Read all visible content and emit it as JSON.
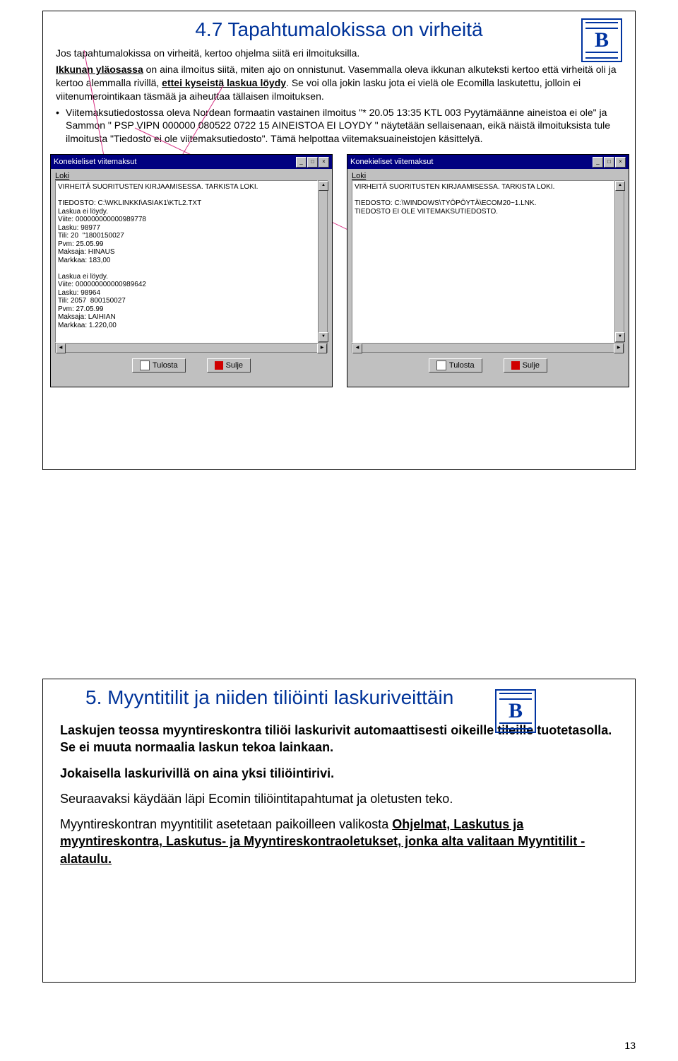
{
  "slide1": {
    "title": "4.7 Tapahtumalokissa on virheitä",
    "p1a": "Jos tapahtumalokissa on virheitä, kertoo ohjelma siitä eri ilmoituksilla.",
    "p2_lead_u": "Ikkunan yläosassa",
    "p2_rest": " on aina ilmoitus siitä, miten ajo on onnistunut. Vasemmalla oleva ikkunan alkuteksti kertoo että virheitä oli ja kertoo alemmalla rivillä, ",
    "p2_mid_u": "ettei kyseistä laskua löydy",
    "p2_tail": ". Se voi olla jokin lasku jota ei vielä ole Ecomilla laskutettu, jolloin ei viitenumerointikaan täsmää ja aiheuttaa tällaisen ilmoituksen.",
    "bullet1": "Viitemaksutiedostossa oleva Nordean formaatin vastainen ilmoitus \"* 20.05 13:35 KTL 003 Pyytämäänne aineistoa ei ole\" ja Sammon \" PSP VIPN 000000 080522 0722 15 AINEISTOA EI LOYDY \" näytetään sellaisenaan, eikä näistä ilmoituksista tule ilmoitusta \"Tiedosto ei ole viitemaksutiedosto\". Tämä helpottaa viitemaksuaineistojen käsittelyä.",
    "win_title": "Konekieliset viitemaksut",
    "loki_label": "Loki",
    "ta_left": "VIRHEITÄ SUORITUSTEN KIRJAAMISESSA. TARKISTA LOKI.\n\nTIEDOSTO: C:\\WKLINKKI\\ASIAK1\\KTL2.TXT\nLaskua ei löydy.\nViite: 000000000000989778\nLasku: 98977\nTili: 20  \"1800150027\nPvm: 25.05.99\nMaksaja: HINAUS\nMarkkaa: 183,00\n\nLaskua ei löydy.\nViite: 000000000000989642\nLasku: 98964\nTili: 2057  800150027\nPvm: 27.05.99\nMaksaja: LAIHIAN\nMarkkaa: 1.220,00",
    "ta_right": "VIRHEITÄ SUORITUSTEN KIRJAAMISESSA. TARKISTA LOKI.\n\nTIEDOSTO: C:\\WINDOWS\\TYÖPÖYTÄ\\ECOM20~1.LNK.\nTIEDOSTO EI OLE VIITEMAKSUTIEDOSTO.",
    "btn_print": "Tulosta",
    "btn_close": "Sulje"
  },
  "slide2": {
    "title": "5. Myyntitilit ja niiden tiliöinti laskuriveittäin",
    "p1_a": "Laskujen teossa myyntireskontra tiliöi laskurivit automaattisesti oikeille tileille tuotetasolla. ",
    "p1_b": "Se ei muuta normaalia laskun tekoa lainkaan.",
    "p2": "Jokaisella laskurivillä on aina yksi tiliöintirivi.",
    "p3": "Seuraavaksi käydään läpi Ecomin tiliöintitapahtumat ja oletusten teko.",
    "p4_a": "Myyntireskontran myyntitilit asetetaan paikoilleen valikosta ",
    "p4_b": "Ohjelmat, Laskutus ja myyntireskontra, Laskutus- ja Myyntireskontraoletukset, jonka alta valitaan Myyntitilit -alataulu."
  },
  "page_number": "13"
}
